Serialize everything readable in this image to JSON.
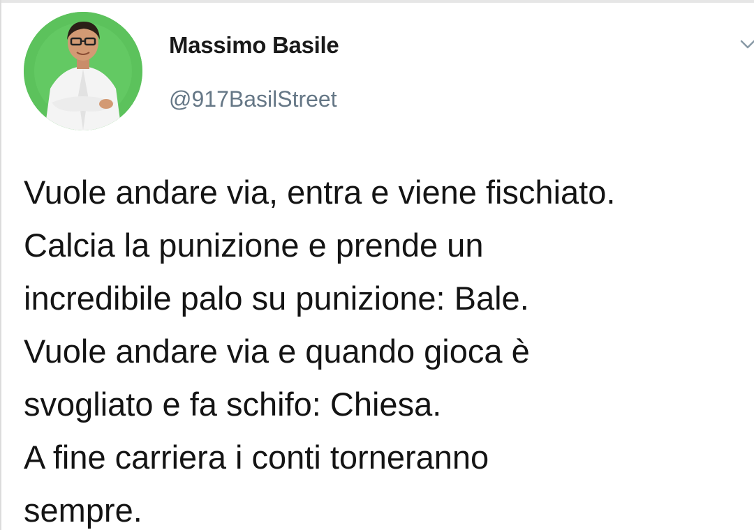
{
  "tweet": {
    "author": {
      "display_name": "Massimo Basile",
      "handle": "@917BasilStreet",
      "avatar_bg_color": "#5cc25c"
    },
    "menu_icon": "chevron-down-icon",
    "text_lines": [
      "Vuole andare via, entra e viene fischiato.",
      "Calcia la punizione e prende un",
      "incredibile palo su punizione: Bale.",
      "Vuole andare via e quando gioca è",
      "svogliato e fa schifo: Chiesa.",
      "A fine carriera i conti torneranno",
      "sempre."
    ]
  }
}
